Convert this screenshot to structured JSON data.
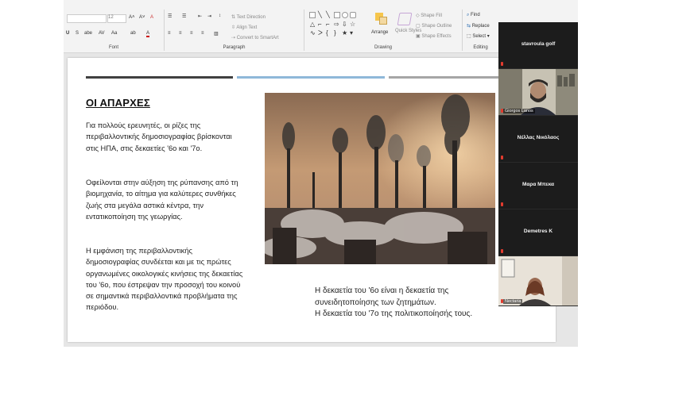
{
  "ribbon": {
    "groups": {
      "font": "Font",
      "paragraph": "Paragraph",
      "drawing": "Drawing",
      "editing": "Editing"
    },
    "font_size": "12",
    "text_direction": "Text Direction",
    "align_text": "Align Text",
    "convert_smartart": "Convert to SmartArt",
    "arrange": "Arrange",
    "quick_styles": "Quick Styles",
    "shape_fill": "Shape Fill",
    "shape_outline": "Shape Outline",
    "shape_effects": "Shape Effects",
    "find": "Find",
    "replace": "Replace",
    "select": "Select"
  },
  "slide": {
    "title": "ΟΙ ΑΠΑΡΧΕΣ",
    "para1": "Για πολλούς ερευνητές, οι ρίζες της περιβαλλοντικής δημοσιογραφίας βρίσκονται στις ΗΠΑ, στις δεκαετίες '6ο και '7ο.",
    "para2": "Οφείλονται στην αύξηση της ρύπανσης από τη βιομηχανία, το αίτημα για καλύτερες συνθήκες ζωής στα μεγάλα αστικά κέντρα, την εντατικοποίηση της γεωργίας.",
    "para3": "Η εμφάνιση της περιβαλλοντικής δημοσιογραφίας συνδέεται και με τις πρώτες οργανωμένες οικολογικές κινήσεις της δεκαετίας του '6ο, που έστρεψαν την προσοχή του κοινού σε σημαντικά περιβαλλοντικά προβλήματα της περιόδου.",
    "caption_line1": "Η δεκαετία του '6ο είναι η δεκαετία της συνειδητοποίησης των ζητημάτων.",
    "caption_line2": "Η δεκαετία του '7ο της πολιτικοποίησής τους."
  },
  "participants": [
    {
      "name": "stavroula golf",
      "video": false
    },
    {
      "name": "Giorgos Lanos",
      "video": true
    },
    {
      "name": "Νέλλας Νικόλαος",
      "video": false
    },
    {
      "name": "Μαρα Μπεκα",
      "video": false
    },
    {
      "name": "Demetres K",
      "video": false
    },
    {
      "name": "Nectaria",
      "video": true
    }
  ],
  "colors": {
    "bar1": "#404040",
    "bar2": "#8fb8d9",
    "bar3": "#a6a6a6",
    "mic_muted": "#e23b2e"
  }
}
